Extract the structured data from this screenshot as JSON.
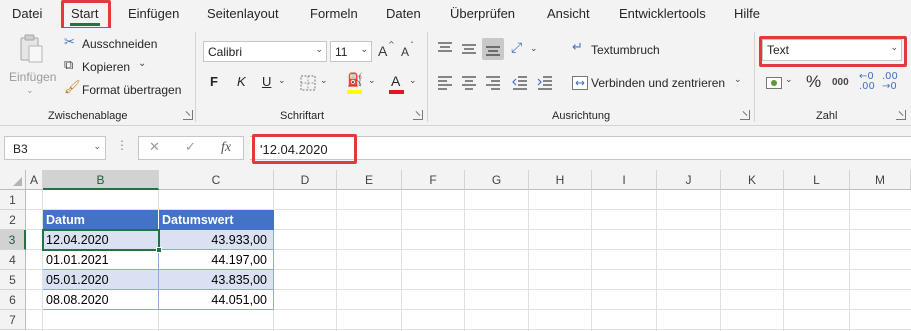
{
  "tabs": [
    "Datei",
    "Start",
    "Einfügen",
    "Seitenlayout",
    "Formeln",
    "Daten",
    "Überprüfen",
    "Ansicht",
    "Entwicklertools",
    "Hilfe"
  ],
  "active_tab": "Start",
  "clipboard": {
    "paste_label": "Einfügen",
    "cut_label": "Ausschneiden",
    "copy_label": "Kopieren",
    "format_painter_label": "Format übertragen",
    "group_label": "Zwischenablage"
  },
  "font": {
    "font_name": "Calibri",
    "font_size": "11",
    "bold": "F",
    "italic": "K",
    "underline": "U",
    "grow": "A",
    "shrink": "A",
    "font_color_glyph": "A",
    "group_label": "Schriftart"
  },
  "alignment": {
    "wrap_label": "Textumbruch",
    "merge_label": "Verbinden und zentrieren",
    "group_label": "Ausrichtung"
  },
  "number": {
    "format_value": "Text",
    "percent": "%",
    "thousands": "000",
    "group_label": "Zahl"
  },
  "formula_bar": {
    "name_box": "B3",
    "fx": "fx",
    "formula": "'12.04.2020"
  },
  "columns": [
    "A",
    "B",
    "C",
    "D",
    "E",
    "F",
    "G",
    "H",
    "I",
    "J",
    "K",
    "L",
    "M"
  ],
  "rows": [
    "1",
    "2",
    "3",
    "4",
    "5",
    "6",
    "7"
  ],
  "table": {
    "headers": [
      "Datum",
      "Datumswert"
    ],
    "rows": [
      [
        "12.04.2020",
        "43.933,00"
      ],
      [
        "01.01.2021",
        "44.197,00"
      ],
      [
        "05.01.2020",
        "43.835,00"
      ],
      [
        "08.08.2020",
        "44.051,00"
      ]
    ]
  },
  "colors": {
    "excel_green": "#217346",
    "table_header": "#4472c4",
    "table_band": "#d9e1f2",
    "highlight": "#e0393e"
  }
}
